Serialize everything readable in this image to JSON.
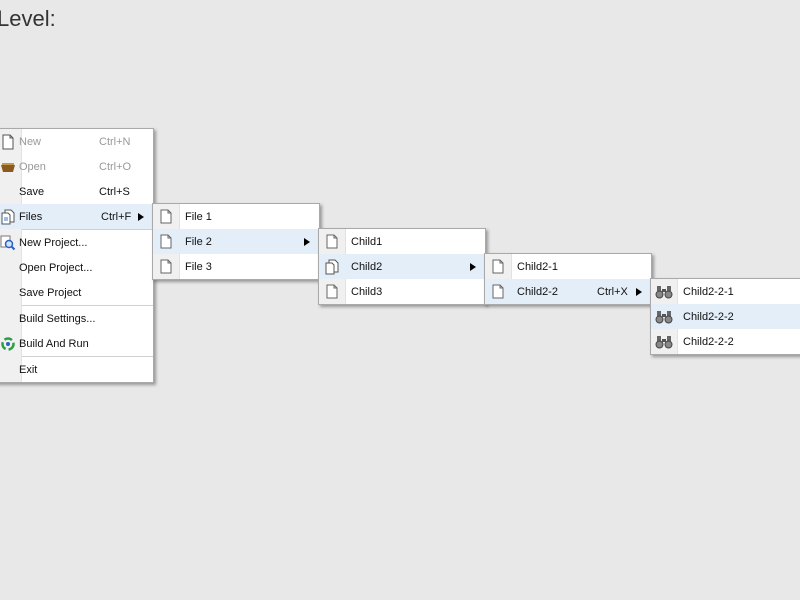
{
  "heading": "i Level:",
  "main_menu": {
    "items": [
      {
        "label": "New",
        "shortcut": "Ctrl+N",
        "icon": "new-file-icon",
        "disabled": true
      },
      {
        "label": "Open",
        "shortcut": "Ctrl+O",
        "icon": "open-folder-icon",
        "disabled": true
      },
      {
        "label": "Save",
        "shortcut": "Ctrl+S",
        "icon": ""
      },
      {
        "label": "Files",
        "shortcut": "Ctrl+F",
        "icon": "files-icon",
        "submenu": true,
        "highlighted": true
      },
      {
        "label": "New Project...",
        "icon": "search-icon",
        "separator_before": true
      },
      {
        "label": "Open Project...",
        "icon": ""
      },
      {
        "label": "Save Project",
        "icon": ""
      },
      {
        "label": "Build Settings...",
        "icon": "",
        "separator_before": true
      },
      {
        "label": "Build And Run",
        "icon": "build-run-icon"
      },
      {
        "label": "Exit",
        "icon": "",
        "separator_before": true
      }
    ]
  },
  "files_menu": {
    "items": [
      {
        "label": "File 1",
        "icon": "document-icon"
      },
      {
        "label": "File 2",
        "icon": "document-icon",
        "submenu": true,
        "highlighted": true
      },
      {
        "label": "File 3",
        "icon": "document-icon"
      }
    ]
  },
  "file2_menu": {
    "items": [
      {
        "label": "Child1",
        "icon": "document-icon"
      },
      {
        "label": "Child2",
        "icon": "documents-icon",
        "submenu": true,
        "highlighted": true
      },
      {
        "label": "Child3",
        "icon": "document-icon"
      }
    ]
  },
  "child2_menu": {
    "items": [
      {
        "label": "Child2-1",
        "icon": "document-icon"
      },
      {
        "label": "Child2-2",
        "shortcut": "Ctrl+X",
        "icon": "document-icon",
        "submenu": true,
        "highlighted": true
      }
    ]
  },
  "child22_menu": {
    "items": [
      {
        "label": "Child2-2-1",
        "icon": "binoculars-icon"
      },
      {
        "label": "Child2-2-2",
        "icon": "binoculars-icon",
        "highlighted": true
      },
      {
        "label": "Child2-2-2",
        "icon": "binoculars-icon"
      }
    ]
  }
}
